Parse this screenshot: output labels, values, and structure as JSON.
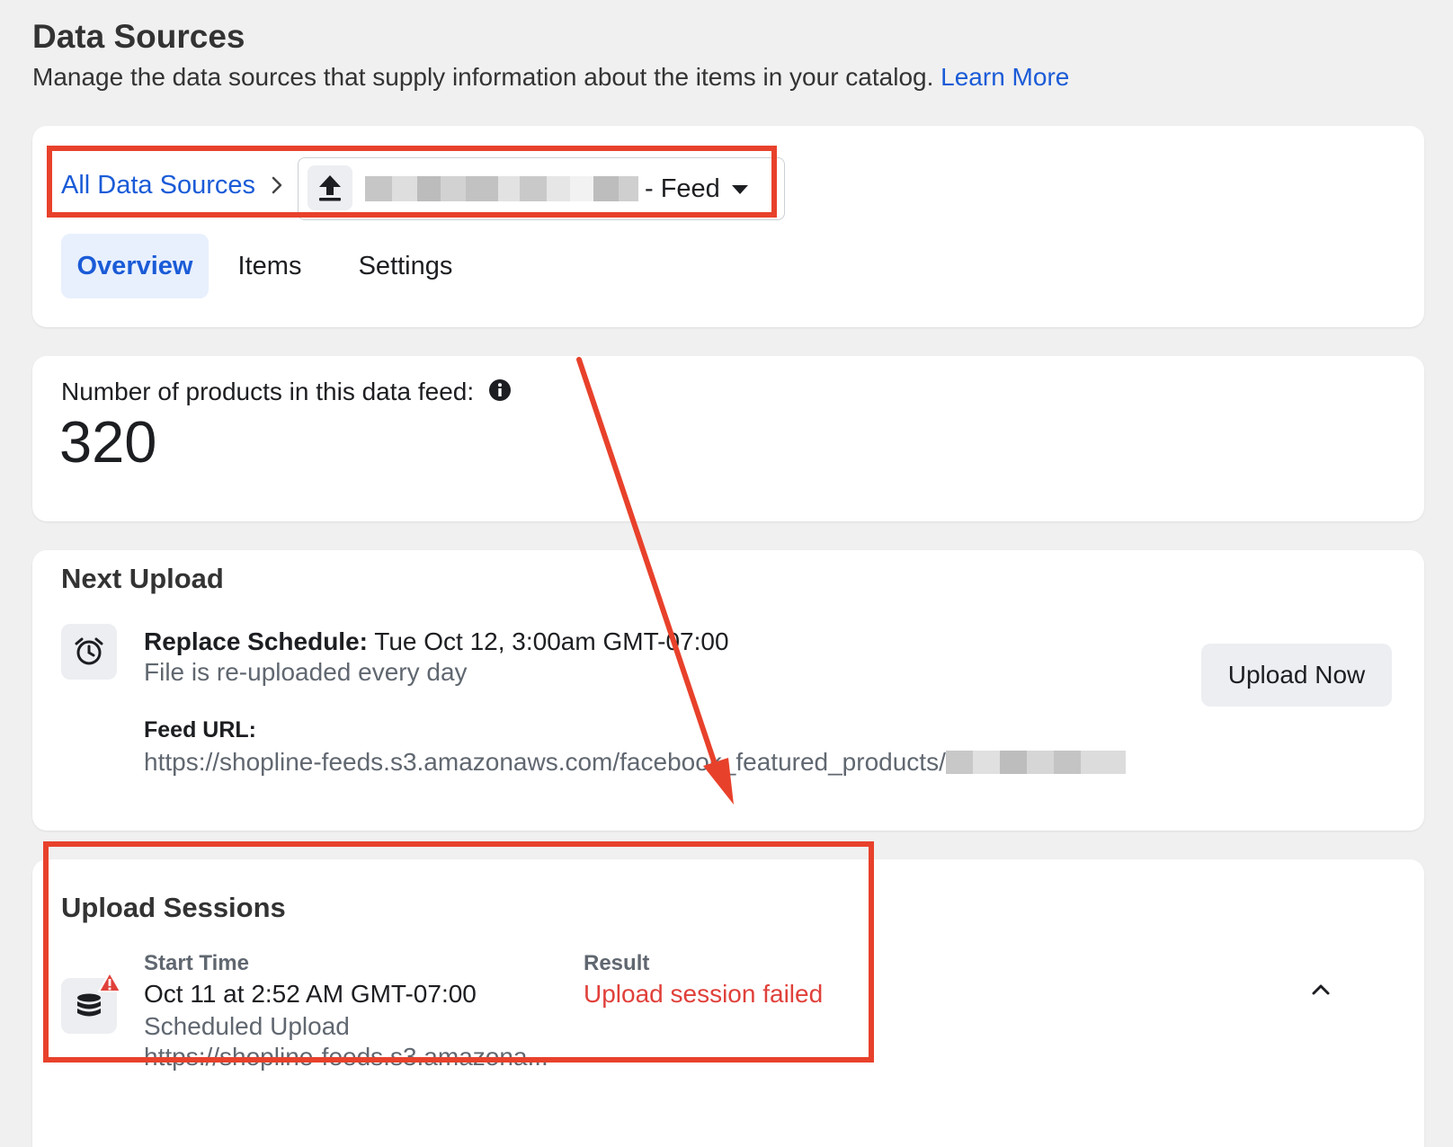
{
  "header": {
    "title": "Data Sources",
    "subtitle": "Manage the data sources that supply information about the items in your catalog.",
    "learn_more": "Learn More"
  },
  "breadcrumb": {
    "root_label": "All Data Sources",
    "current_source_label": "- Feed"
  },
  "tabs": [
    {
      "label": "Overview",
      "active": true
    },
    {
      "label": "Items",
      "active": false
    },
    {
      "label": "Settings",
      "active": false
    }
  ],
  "product_count": {
    "label": "Number of products in this data feed:",
    "value": "320"
  },
  "next_upload": {
    "title": "Next Upload",
    "schedule_label": "Replace Schedule:",
    "schedule_value": "Tue Oct 12, 3:00am GMT-07:00",
    "frequency": "File is re-uploaded every day",
    "feed_url_label": "Feed URL:",
    "feed_url": "https://shopline-feeds.s3.amazonaws.com/facebook_featured_products/",
    "upload_now_label": "Upload Now"
  },
  "upload_sessions": {
    "title": "Upload Sessions",
    "start_time_header": "Start Time",
    "result_header": "Result",
    "start_time": "Oct 11 at 2:52 AM GMT-07:00",
    "upload_type": "Scheduled Upload",
    "url": "https://shopline-feeds.s3.amazona...",
    "result": "Upload session failed"
  },
  "colors": {
    "link": "#1a5bd7",
    "error": "#e0403a",
    "annotation": "#e8412b"
  },
  "icons": [
    "chevron-right-icon",
    "upload-icon",
    "caret-down-icon",
    "info-icon",
    "alarm-clock-icon",
    "database-icon",
    "warning-icon",
    "chevron-up-icon"
  ]
}
